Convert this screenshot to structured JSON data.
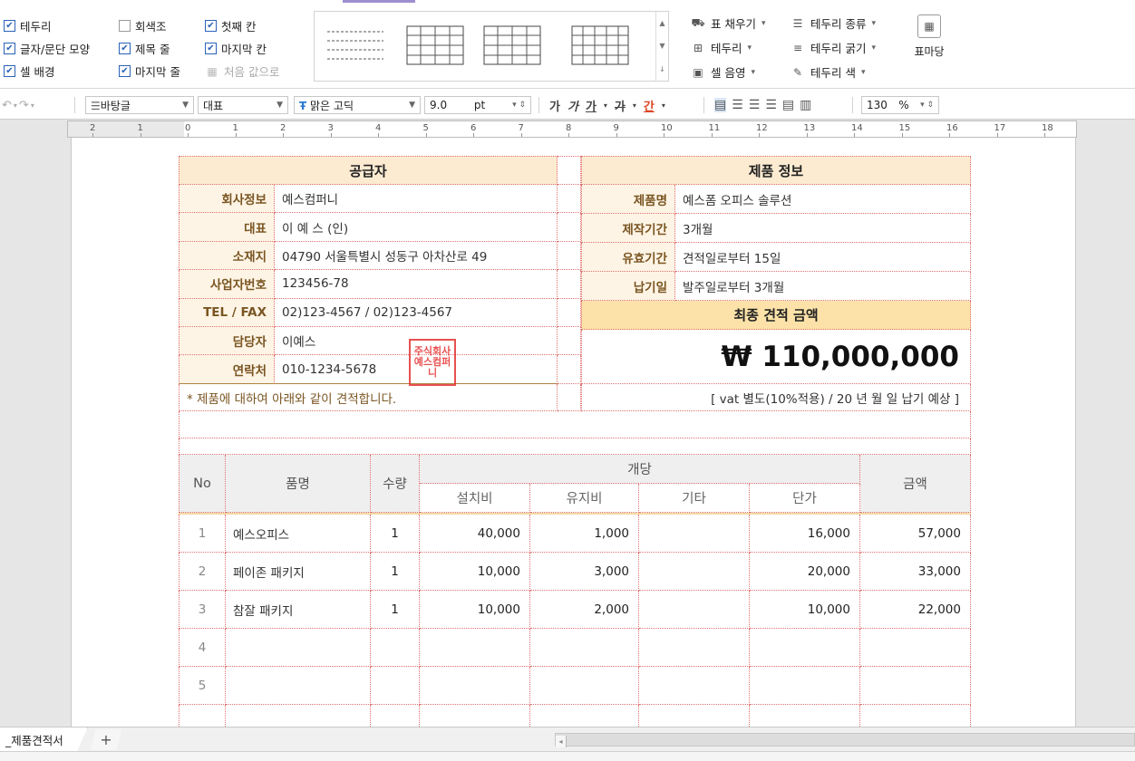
{
  "ribbon": {
    "options": [
      {
        "label": "테두리",
        "checked": true
      },
      {
        "label": "글자/문단 모양",
        "checked": true
      },
      {
        "label": "셀 배경",
        "checked": true
      },
      {
        "label": "회색조",
        "checked": false
      },
      {
        "label": "제목 줄",
        "checked": true
      },
      {
        "label": "마지막 줄",
        "checked": true
      },
      {
        "label": "첫째 칸",
        "checked": true
      },
      {
        "label": "마지막 칸",
        "checked": true
      },
      {
        "label": "처음 값으로",
        "checked": false
      }
    ],
    "fill_label": "표 채우기",
    "border_label": "테두리",
    "shade_label": "셀 음영",
    "border_type_label": "테두리 종류",
    "border_width_label": "테두리 굵기",
    "border_color_label": "테두리 색",
    "table_margin_label": "표마당"
  },
  "format": {
    "style": "바탕글",
    "section": "대표",
    "font": "맑은 고딕",
    "size": "9.0",
    "unit": "pt",
    "bold": "가",
    "italic": "가",
    "underline": "가",
    "strike": "가",
    "color_char": "간",
    "zoom": "130",
    "zoom_unit": "%"
  },
  "ruler": {
    "labels": [
      "2",
      "1",
      "0",
      "1",
      "2",
      "3",
      "4",
      "5",
      "6",
      "7",
      "8",
      "9",
      "10",
      "11",
      "12",
      "13",
      "14",
      "15",
      "16",
      "17",
      "18"
    ]
  },
  "supplier": {
    "title": "공급자",
    "rows": [
      {
        "label": "회사정보",
        "value": "예스컴퍼니"
      },
      {
        "label": "대표",
        "value": "이 예 스 (인)"
      },
      {
        "label": "소재지",
        "value": "04790 서울특별시 성동구 아차산로 49"
      },
      {
        "label": "사업자번호",
        "value": "123456-78"
      },
      {
        "label": "TEL / FAX",
        "value": "02)123-4567 / 02)123-4567"
      },
      {
        "label": "담당자",
        "value": "이예스"
      },
      {
        "label": "연락처",
        "value": "010-1234-5678"
      }
    ],
    "note": "* 제품에 대하여 아래와 같이 견적합니다."
  },
  "stamp": {
    "text": "주식회사 예스컴퍼니"
  },
  "product": {
    "title": "제품 정보",
    "rows": [
      {
        "label": "제품명",
        "value": "예스폼 오피스 솔루션"
      },
      {
        "label": "제작기간",
        "value": "3개월"
      },
      {
        "label": "유효기간",
        "value": "견적일로부터 15일"
      },
      {
        "label": "납기일",
        "value": "발주일로부터 3개월"
      }
    ],
    "total_title": "최종 견적 금액",
    "total_amount": "₩ 110,000,000",
    "note": "[ vat 별도(10%적용) / 20  년  월  일 납기 예상 ]"
  },
  "items": {
    "headers": {
      "no": "No",
      "name": "품명",
      "qty": "수량",
      "unit_group": "개당",
      "setup": "설치비",
      "maint": "유지비",
      "etc": "기타",
      "price": "단가",
      "amount": "금액"
    },
    "rows": [
      {
        "no": "1",
        "name": "예스오피스",
        "qty": "1",
        "setup": "40,000",
        "maint": "1,000",
        "etc": "",
        "price": "16,000",
        "amount": "57,000"
      },
      {
        "no": "2",
        "name": "페이존 패키지",
        "qty": "1",
        "setup": "10,000",
        "maint": "3,000",
        "etc": "",
        "price": "20,000",
        "amount": "33,000"
      },
      {
        "no": "3",
        "name": "참잘 패키지",
        "qty": "1",
        "setup": "10,000",
        "maint": "2,000",
        "etc": "",
        "price": "10,000",
        "amount": "22,000"
      },
      {
        "no": "4",
        "name": "",
        "qty": "",
        "setup": "",
        "maint": "",
        "etc": "",
        "price": "",
        "amount": ""
      },
      {
        "no": "5",
        "name": "",
        "qty": "",
        "setup": "",
        "maint": "",
        "etc": "",
        "price": "",
        "amount": ""
      }
    ]
  },
  "sheet": {
    "tab": "_제품견적서",
    "add": "+"
  }
}
